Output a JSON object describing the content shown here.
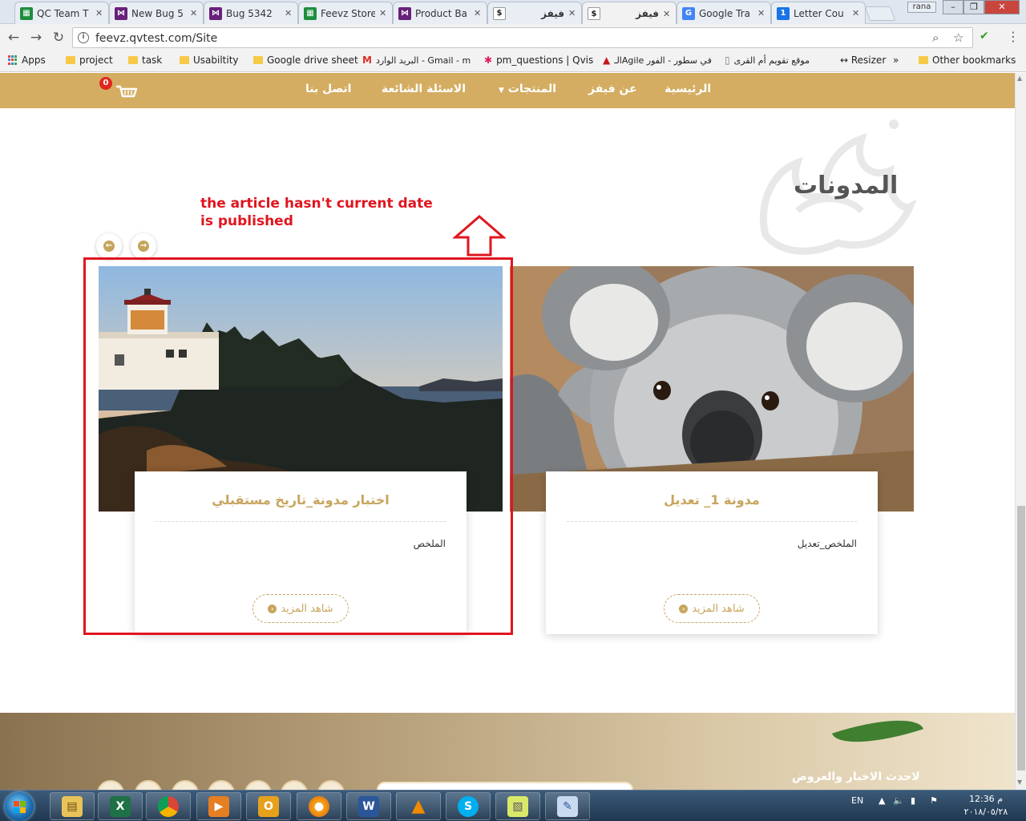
{
  "browser": {
    "tabs": [
      {
        "title": "QC Team T",
        "icon": "sheets-icon",
        "color": "#1e8e3e"
      },
      {
        "title": "New Bug 5",
        "icon": "visualstudio-icon",
        "color": "#68217a"
      },
      {
        "title": "Bug 5342",
        "icon": "visualstudio-icon",
        "color": "#68217a"
      },
      {
        "title": "Feevz Store",
        "icon": "sheets-icon",
        "color": "#1e8e3e"
      },
      {
        "title": "Product Ba",
        "icon": "visualstudio-icon",
        "color": "#68217a"
      },
      {
        "title": "فيفز",
        "icon": "dollar-icon",
        "color": "#ffffff"
      },
      {
        "title": "فيفز",
        "icon": "dollar-icon",
        "color": "#ffffff"
      },
      {
        "title": "Google Tra",
        "icon": "translate-icon",
        "color": "#4285f4"
      },
      {
        "title": "Letter Cou",
        "icon": "number-one-icon",
        "color": "#1a73e8"
      }
    ],
    "user": "rana",
    "url": "feevz.qvtest.com/Site",
    "bookmarks": {
      "apps": "Apps",
      "project": "project",
      "task": "task",
      "usability": "Usabiltity",
      "drive": "Google drive sheet",
      "gmail": "البريد الوارد - Gmail - m",
      "pm": "pm_questions | Qvis",
      "agile": "الـAgile في سطور - الفور",
      "calendar": "موقع تقويم أم القرى",
      "resizer": "↔ Resizer",
      "overflow": "»",
      "other": "Other bookmarks"
    }
  },
  "site": {
    "nav": {
      "home": "الرئيسية",
      "about": "عن فيفز",
      "products": "المنتجات",
      "faq": "الاسئلة الشائعة",
      "contact": "اتصل بنا",
      "cart_count": "0"
    },
    "blogs_title": "المدونات",
    "annotation": {
      "line1": "the article hasn't current date",
      "line2": "is published"
    },
    "posts": [
      {
        "title": "اختبار مدونة_تاريخ مستقبلي",
        "summary": "الملخص",
        "more": "شاهد المزيد",
        "image": "lighthouse"
      },
      {
        "title": "مدونة 1_ تعديل",
        "summary": "الملخص_تعديل",
        "more": "شاهد المزيد",
        "image": "koala"
      }
    ],
    "footer_heading": "لاحدث الاخبار والعروض"
  },
  "taskbar": {
    "apps": [
      "file-explorer-icon",
      "excel-icon",
      "chrome-icon",
      "media-player-icon",
      "outlook-icon",
      "firefox-icon",
      "word-icon",
      "vlc-icon",
      "skype-icon",
      "sticky-notes-icon",
      "paint-icon"
    ],
    "lang": "EN",
    "time": "12:36 م",
    "date": "٢٠١٨/٠٥/٢٨"
  }
}
